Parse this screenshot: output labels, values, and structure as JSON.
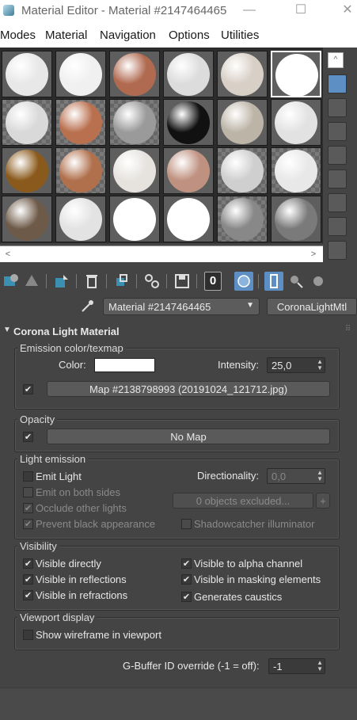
{
  "window": {
    "title": "Material Editor - Material #2147464465",
    "minimize": "—",
    "maximize": "☐",
    "close": "✕"
  },
  "menu": [
    "Modes",
    "Material",
    "Navigation",
    "Options",
    "Utilities"
  ],
  "samples": [
    {
      "row": 0,
      "col": 0,
      "color": "#e8e8e8",
      "bg": "plain"
    },
    {
      "row": 0,
      "col": 1,
      "color": "#f0f0f0",
      "bg": "plain"
    },
    {
      "row": 0,
      "col": 2,
      "color": "#b06a50",
      "bg": "plain"
    },
    {
      "row": 0,
      "col": 3,
      "color": "#dcdcdc",
      "bg": "plain"
    },
    {
      "row": 0,
      "col": 4,
      "color": "#d8cfc6",
      "bg": "plain"
    },
    {
      "row": 0,
      "col": 5,
      "color": "#ffffff",
      "bg": "plain",
      "selected": true
    },
    {
      "row": 1,
      "col": 0,
      "color": "#d9d9d9",
      "bg": "checker"
    },
    {
      "row": 1,
      "col": 1,
      "color": "#b9704f",
      "bg": "checker"
    },
    {
      "row": 1,
      "col": 2,
      "color": "#9a9a9a",
      "bg": "checker"
    },
    {
      "row": 1,
      "col": 3,
      "color": "#111111",
      "bg": "plain"
    },
    {
      "row": 1,
      "col": 4,
      "color": "#bcb4a7",
      "bg": "plain"
    },
    {
      "row": 1,
      "col": 5,
      "color": "#e2e2e2",
      "bg": "plain"
    },
    {
      "row": 2,
      "col": 0,
      "color": "#8a5a1c",
      "bg": "plain"
    },
    {
      "row": 2,
      "col": 1,
      "color": "#b0704c",
      "bg": "checker"
    },
    {
      "row": 2,
      "col": 2,
      "color": "#e6e3df",
      "bg": "plain"
    },
    {
      "row": 2,
      "col": 3,
      "color": "#bf9180",
      "bg": "plain"
    },
    {
      "row": 2,
      "col": 4,
      "color": "#cfcfcf",
      "bg": "checker"
    },
    {
      "row": 2,
      "col": 5,
      "color": "#e8e8e8",
      "bg": "checker"
    },
    {
      "row": 3,
      "col": 0,
      "color": "#6e5a48",
      "bg": "plain"
    },
    {
      "row": 3,
      "col": 1,
      "color": "#e3e3e3",
      "bg": "plain"
    },
    {
      "row": 3,
      "col": 2,
      "color": "#ffffff",
      "bg": "plain"
    },
    {
      "row": 3,
      "col": 3,
      "color": "#ffffff",
      "bg": "plain"
    },
    {
      "row": 3,
      "col": 4,
      "color": "#888888",
      "bg": "checker"
    },
    {
      "row": 3,
      "col": 5,
      "color": "#7a7a7a",
      "bg": "plain"
    }
  ],
  "scroll": {
    "left": "<",
    "right": ">",
    "up": "^",
    "down": "v"
  },
  "material_name": "Material #2147464465",
  "material_type": "CoronaLightMtl",
  "bottom_toolbar": {
    "map_id_value": "0"
  },
  "rollout": {
    "title": "Corona Light Material"
  },
  "emission": {
    "title": "Emission color/texmap",
    "color_label": "Color:",
    "color_value": "#ffffff",
    "intensity_label": "Intensity:",
    "intensity_value": "25,0",
    "map_checked": "✔",
    "map_button": "Map #2138798993 (20191024_121712.jpg)"
  },
  "opacity": {
    "title": "Opacity",
    "checked": "✔",
    "button": "No Map"
  },
  "light_emission": {
    "title": "Light emission",
    "emit_light": "Emit Light",
    "directionality_label": "Directionality:",
    "directionality_value": "0,0",
    "emit_both": "Emit on both sides",
    "objects_excluded": "0 objects excluded...",
    "plus": "+",
    "occlude": "Occlude other lights",
    "occlude_check": "✔",
    "prevent_black": "Prevent black appearance",
    "prevent_check": "✔",
    "shadowcatcher": "Shadowcatcher illuminator"
  },
  "visibility": {
    "title": "Visibility",
    "check": "✔",
    "visible_directly": "Visible directly",
    "visible_reflections": "Visible in reflections",
    "visible_refractions": "Visible in refractions",
    "visible_alpha": "Visible to alpha channel",
    "visible_masking": "Visible in masking elements",
    "generates_caustics": "Generates caustics"
  },
  "viewport": {
    "title": "Viewport display",
    "show_wireframe": "Show wireframe in viewport"
  },
  "gbuffer": {
    "label": "G-Buffer ID override (-1 = off):",
    "value": "-1"
  }
}
